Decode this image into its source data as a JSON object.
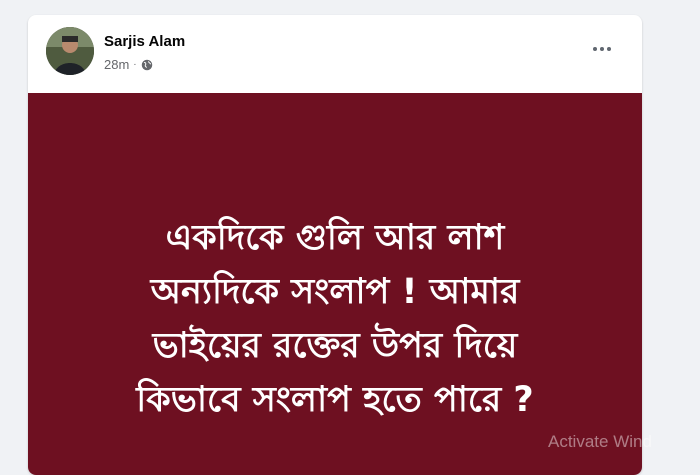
{
  "post": {
    "author": "Sarjis Alam",
    "time": "28m",
    "separator": "·",
    "privacy_icon": "globe-icon",
    "menu_icon": "more-horizontal-icon",
    "image_bg_color": "#6e1021",
    "text_lines": [
      "একদিকে গুলি আর লাশ",
      "অন্যদিকে সংলাপ ! আমার",
      "ভাইয়ের রক্তের উপর দিয়ে",
      "কিভাবে সংলাপ হতে পারে ?"
    ]
  },
  "overlay": {
    "watermark": "Activate Wind"
  }
}
